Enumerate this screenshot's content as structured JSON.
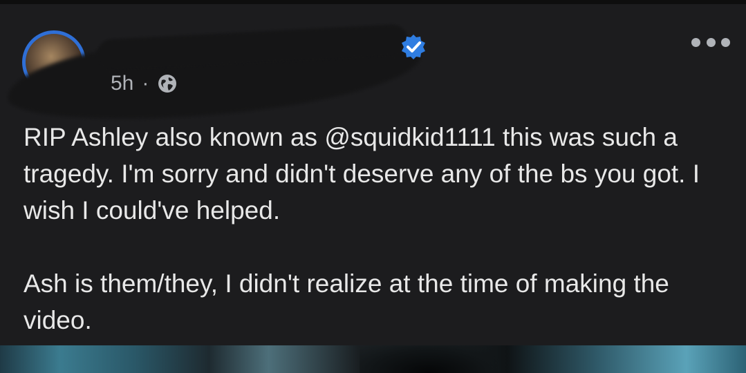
{
  "post": {
    "author_name_visible": "",
    "time": "5h",
    "separator": "·",
    "audience_icon": "globe-icon",
    "verified_icon": "verified-badge-icon",
    "more_icon": "more-options-icon",
    "body_paragraph_1": "RIP Ashley also known as @squidkid1111 this was such a tragedy. I'm sorry and didn't deserve any of the bs you got. I wish I could've helped.",
    "body_paragraph_2": "Ash is them/they, I didn't realize at the time of making the video."
  },
  "colors": {
    "background": "#1c1c1e",
    "text": "#e8e8e8",
    "meta_text": "#b0b3b8",
    "verified": "#2f7de1",
    "avatar_ring": "#2f6fd6"
  }
}
